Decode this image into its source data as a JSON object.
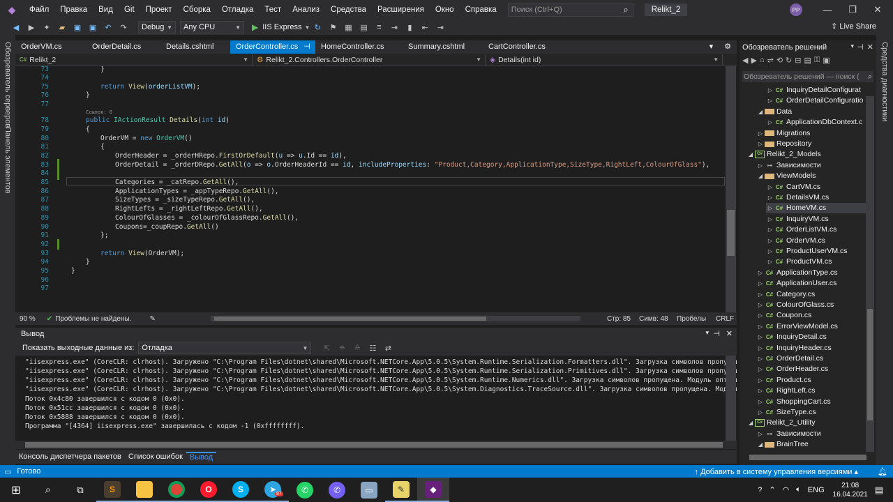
{
  "menubar": {
    "items": [
      "Файл",
      "Правка",
      "Вид",
      "Git",
      "Проект",
      "Сборка",
      "Отладка",
      "Тест",
      "Анализ",
      "Средства",
      "Расширения",
      "Окно",
      "Справка"
    ],
    "search_placeholder": "Поиск (Ctrl+Q)",
    "solution_title": "Relikt_2",
    "avatar": "PP"
  },
  "toolbar": {
    "config": "Debug",
    "platform": "Any CPU",
    "run_target": "IIS Express",
    "live_share": "Live Share"
  },
  "left_strip": {
    "server_explorer": "Обозреватель серверов",
    "toolbox": "Панель элементов"
  },
  "right_strip": {
    "diagnostics": "Средства диагностики"
  },
  "tabs": [
    {
      "label": "OrderVM.cs",
      "active": false
    },
    {
      "label": "OrderDetail.cs",
      "active": false
    },
    {
      "label": "Details.cshtml",
      "active": false
    },
    {
      "label": "OrderController.cs",
      "active": true
    },
    {
      "label": "HomeController.cs",
      "active": false
    },
    {
      "label": "Summary.cshtml",
      "active": false
    },
    {
      "label": "CartController.cs",
      "active": false
    }
  ],
  "nav": {
    "project": "Relikt_2",
    "class": "Relikt_2.Controllers.OrderController",
    "member": "Details(int id)"
  },
  "editor": {
    "refs": "Ссылок: 0",
    "line_numbers": [
      "73",
      "74",
      "75",
      "76",
      "77",
      "78",
      "79",
      "80",
      "81",
      "82",
      "83",
      "84",
      "85",
      "86",
      "87",
      "88",
      "89",
      "90",
      "91",
      "92",
      "93",
      "94",
      "95",
      "96",
      "97"
    ]
  },
  "status_row": {
    "zoom": "90 %",
    "issues": "Проблемы не найдены.",
    "line": "Стр: 85",
    "col": "Симв: 48",
    "spaces": "Пробелы",
    "eol": "CRLF"
  },
  "output": {
    "title": "Вывод",
    "show_from_label": "Показать выходные данные из:",
    "source": "Отладка",
    "lines": [
      "\"iisexpress.exe\" (CoreCLR: clrhost). Загружено \"C:\\Program Files\\dotnet\\shared\\Microsoft.NETCore.App\\5.0.5\\System.Runtime.Serialization.Formatters.dll\". Загрузка символов пропущена. Модуль",
      "\"iisexpress.exe\" (CoreCLR: clrhost). Загружено \"C:\\Program Files\\dotnet\\shared\\Microsoft.NETCore.App\\5.0.5\\System.Runtime.Serialization.Primitives.dll\". Загрузка символов пропущена. Модуль",
      "\"iisexpress.exe\" (CoreCLR: clrhost). Загружено \"C:\\Program Files\\dotnet\\shared\\Microsoft.NETCore.App\\5.0.5\\System.Runtime.Numerics.dll\". Загрузка символов пропущена. Модуль оптимизирован,",
      "\"iisexpress.exe\" (CoreCLR: clrhost). Загружено \"C:\\Program Files\\dotnet\\shared\\Microsoft.NETCore.App\\5.0.5\\System.Diagnostics.TraceSource.dll\". Загрузка символов пропущена. Модуль оптимизи",
      "Поток 0x4c80 завершился с кодом 0 (0x0).",
      "Поток 0x51cc завершился с кодом 0 (0x0).",
      "Поток 0x5888 завершился с кодом 0 (0x0).",
      "Программа \"[4364] iisexpress.exe\" завершилась с кодом -1 (0xffffffff)."
    ]
  },
  "bottom_tabs": [
    "Консоль диспетчера пакетов",
    "Список ошибок",
    "Вывод"
  ],
  "solution_explorer": {
    "title": "Обозреватель решений",
    "search_placeholder": "Обозреватель решений — поиск (",
    "items": [
      {
        "label": "InquiryDetailConfigurat",
        "indent": 3,
        "icon": "cs",
        "chev": "▷"
      },
      {
        "label": "OrderDetailConfiguratio",
        "indent": 3,
        "icon": "cs",
        "chev": "▷"
      },
      {
        "label": "Data",
        "indent": 2,
        "icon": "folder",
        "chev": "◢"
      },
      {
        "label": "ApplicationDbContext.c",
        "indent": 3,
        "icon": "cs",
        "chev": "▷"
      },
      {
        "label": "Migrations",
        "indent": 2,
        "icon": "folder",
        "chev": "▷"
      },
      {
        "label": "Repository",
        "indent": 2,
        "icon": "folder",
        "chev": "▷"
      },
      {
        "label": "Relikt_2_Models",
        "indent": 1,
        "icon": "proj",
        "chev": "◢"
      },
      {
        "label": "Зависимости",
        "indent": 2,
        "icon": "deps",
        "chev": "▷"
      },
      {
        "label": "ViewModels",
        "indent": 2,
        "icon": "folder",
        "chev": "◢"
      },
      {
        "label": "CartVM.cs",
        "indent": 3,
        "icon": "cs",
        "chev": "▷"
      },
      {
        "label": "DetailsVM.cs",
        "indent": 3,
        "icon": "cs",
        "chev": "▷"
      },
      {
        "label": "HomeVM.cs",
        "indent": 3,
        "icon": "cs",
        "chev": "▷",
        "selected": true
      },
      {
        "label": "InquiryVM.cs",
        "indent": 3,
        "icon": "cs",
        "chev": "▷"
      },
      {
        "label": "OrderListVM.cs",
        "indent": 3,
        "icon": "cs",
        "chev": "▷"
      },
      {
        "label": "OrderVM.cs",
        "indent": 3,
        "icon": "cs",
        "chev": "▷"
      },
      {
        "label": "ProductUserVM.cs",
        "indent": 3,
        "icon": "cs",
        "chev": "▷"
      },
      {
        "label": "ProductVM.cs",
        "indent": 3,
        "icon": "cs",
        "chev": "▷"
      },
      {
        "label": "ApplicationType.cs",
        "indent": 2,
        "icon": "cs",
        "chev": "▷"
      },
      {
        "label": "ApplicationUser.cs",
        "indent": 2,
        "icon": "cs",
        "chev": "▷"
      },
      {
        "label": "Category.cs",
        "indent": 2,
        "icon": "cs",
        "chev": "▷"
      },
      {
        "label": "ColourOfGlass.cs",
        "indent": 2,
        "icon": "cs",
        "chev": "▷"
      },
      {
        "label": "Coupon.cs",
        "indent": 2,
        "icon": "cs",
        "chev": "▷"
      },
      {
        "label": "ErrorViewModel.cs",
        "indent": 2,
        "icon": "cs",
        "chev": "▷"
      },
      {
        "label": "InquiryDetail.cs",
        "indent": 2,
        "icon": "cs",
        "chev": "▷"
      },
      {
        "label": "InquiryHeader.cs",
        "indent": 2,
        "icon": "cs",
        "chev": "▷"
      },
      {
        "label": "OrderDetail.cs",
        "indent": 2,
        "icon": "cs",
        "chev": "▷"
      },
      {
        "label": "OrderHeader.cs",
        "indent": 2,
        "icon": "cs",
        "chev": "▷"
      },
      {
        "label": "Product.cs",
        "indent": 2,
        "icon": "cs",
        "chev": "▷"
      },
      {
        "label": "RightLeft.cs",
        "indent": 2,
        "icon": "cs",
        "chev": "▷"
      },
      {
        "label": "ShoppingCart.cs",
        "indent": 2,
        "icon": "cs",
        "chev": "▷"
      },
      {
        "label": "SizeType.cs",
        "indent": 2,
        "icon": "cs",
        "chev": "▷"
      },
      {
        "label": "Relikt_2_Utility",
        "indent": 1,
        "icon": "proj",
        "chev": "◢"
      },
      {
        "label": "Зависимости",
        "indent": 2,
        "icon": "deps",
        "chev": "▷"
      },
      {
        "label": "BrainTree",
        "indent": 2,
        "icon": "folder",
        "chev": "◢"
      }
    ]
  },
  "statusbar": {
    "ready": "Готово",
    "vcs": "Добавить в систему управления версиями"
  },
  "taskbar": {
    "lang": "ENG",
    "time": "21:08",
    "date": "16.04.2021",
    "telegram_badge": "87"
  }
}
